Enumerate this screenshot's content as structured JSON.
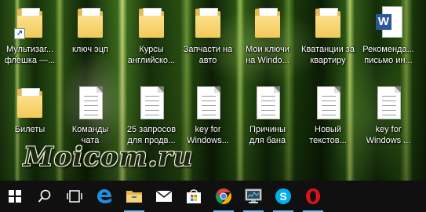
{
  "desktop": {
    "row1": [
      {
        "label_line1": "Мультизаг...",
        "label_line2": "флешка —...",
        "icon": "folder-shortcut-icon"
      },
      {
        "label_line1": "ключ эцп",
        "label_line2": "",
        "icon": "folder-icon"
      },
      {
        "label_line1": "Курсы",
        "label_line2": "английско...",
        "icon": "folder-icon"
      },
      {
        "label_line1": "Запчасти на",
        "label_line2": "авто",
        "icon": "folder-icon"
      },
      {
        "label_line1": "Мои ключи",
        "label_line2": "на Windo...",
        "icon": "folder-icon"
      },
      {
        "label_line1": "Кватанции за",
        "label_line2": "квартиру",
        "icon": "folder-icon"
      },
      {
        "label_line1": "Рекоменда...",
        "label_line2": "письмо ин...",
        "icon": "word-document-icon"
      }
    ],
    "row2": [
      {
        "label_line1": "Билеты",
        "label_line2": "",
        "icon": "folder-icon"
      },
      {
        "label_line1": "Команды",
        "label_line2": "чата",
        "icon": "text-document-icon"
      },
      {
        "label_line1": "25 запросов",
        "label_line2": "для продв...",
        "icon": "text-document-icon"
      },
      {
        "label_line1": "key for",
        "label_line2": "Windows...",
        "icon": "text-document-icon"
      },
      {
        "label_line1": "Причины",
        "label_line2": "для бана",
        "icon": "text-document-icon"
      },
      {
        "label_line1": "Новый",
        "label_line2": "текстов...",
        "icon": "text-document-icon"
      },
      {
        "label_line1": "key for",
        "label_line2": "Windows ...",
        "icon": "text-document-icon"
      }
    ]
  },
  "watermark": "Moicom.ru",
  "taskbar": {
    "items": [
      "start-icon",
      "search-icon",
      "task-view-icon",
      "edge-icon",
      "file-explorer-icon",
      "mail-icon",
      "store-icon",
      "chrome-icon",
      "monitor-app-icon",
      "skype-icon",
      "opera-icon"
    ]
  },
  "colors": {
    "taskbar": "#101010",
    "folder": "#f2c95a",
    "word": "#2b579a",
    "edge": "#1e90e0",
    "skype": "#00aff0",
    "opera": "#e0111b"
  }
}
